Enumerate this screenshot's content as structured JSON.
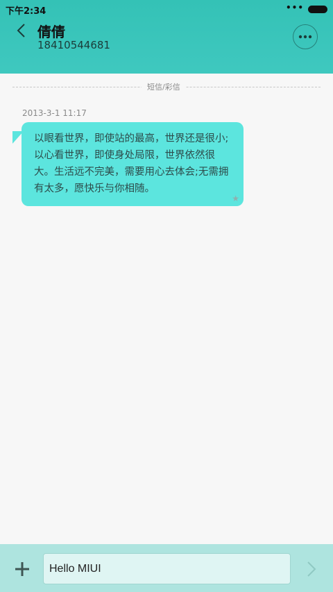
{
  "status_bar": {
    "time": "下午2:34",
    "dots": "•••"
  },
  "header": {
    "contact_name": "倩倩",
    "contact_number": "18410544681"
  },
  "conversation": {
    "divider_label": "短信/彩信",
    "timestamp": "2013-3-1 11:17",
    "messages": [
      {
        "text": "以眼看世界，即使站的最高，世界还是很小;以心看世界，即使身处局限，世界依然很大。生活远不完美，需要用心去体会;无需拥有太多，愿快乐与你相随。"
      }
    ]
  },
  "composer": {
    "input_value": "Hello MIUI"
  },
  "colors": {
    "header": "#3fc8bf",
    "bubble": "#5ce5de",
    "bottom_bar": "#aee4df"
  },
  "icons": {
    "back": "chevron-left-icon",
    "more": "more-icon",
    "add": "plus-icon",
    "send": "chevron-right-icon",
    "star": "star-icon"
  }
}
